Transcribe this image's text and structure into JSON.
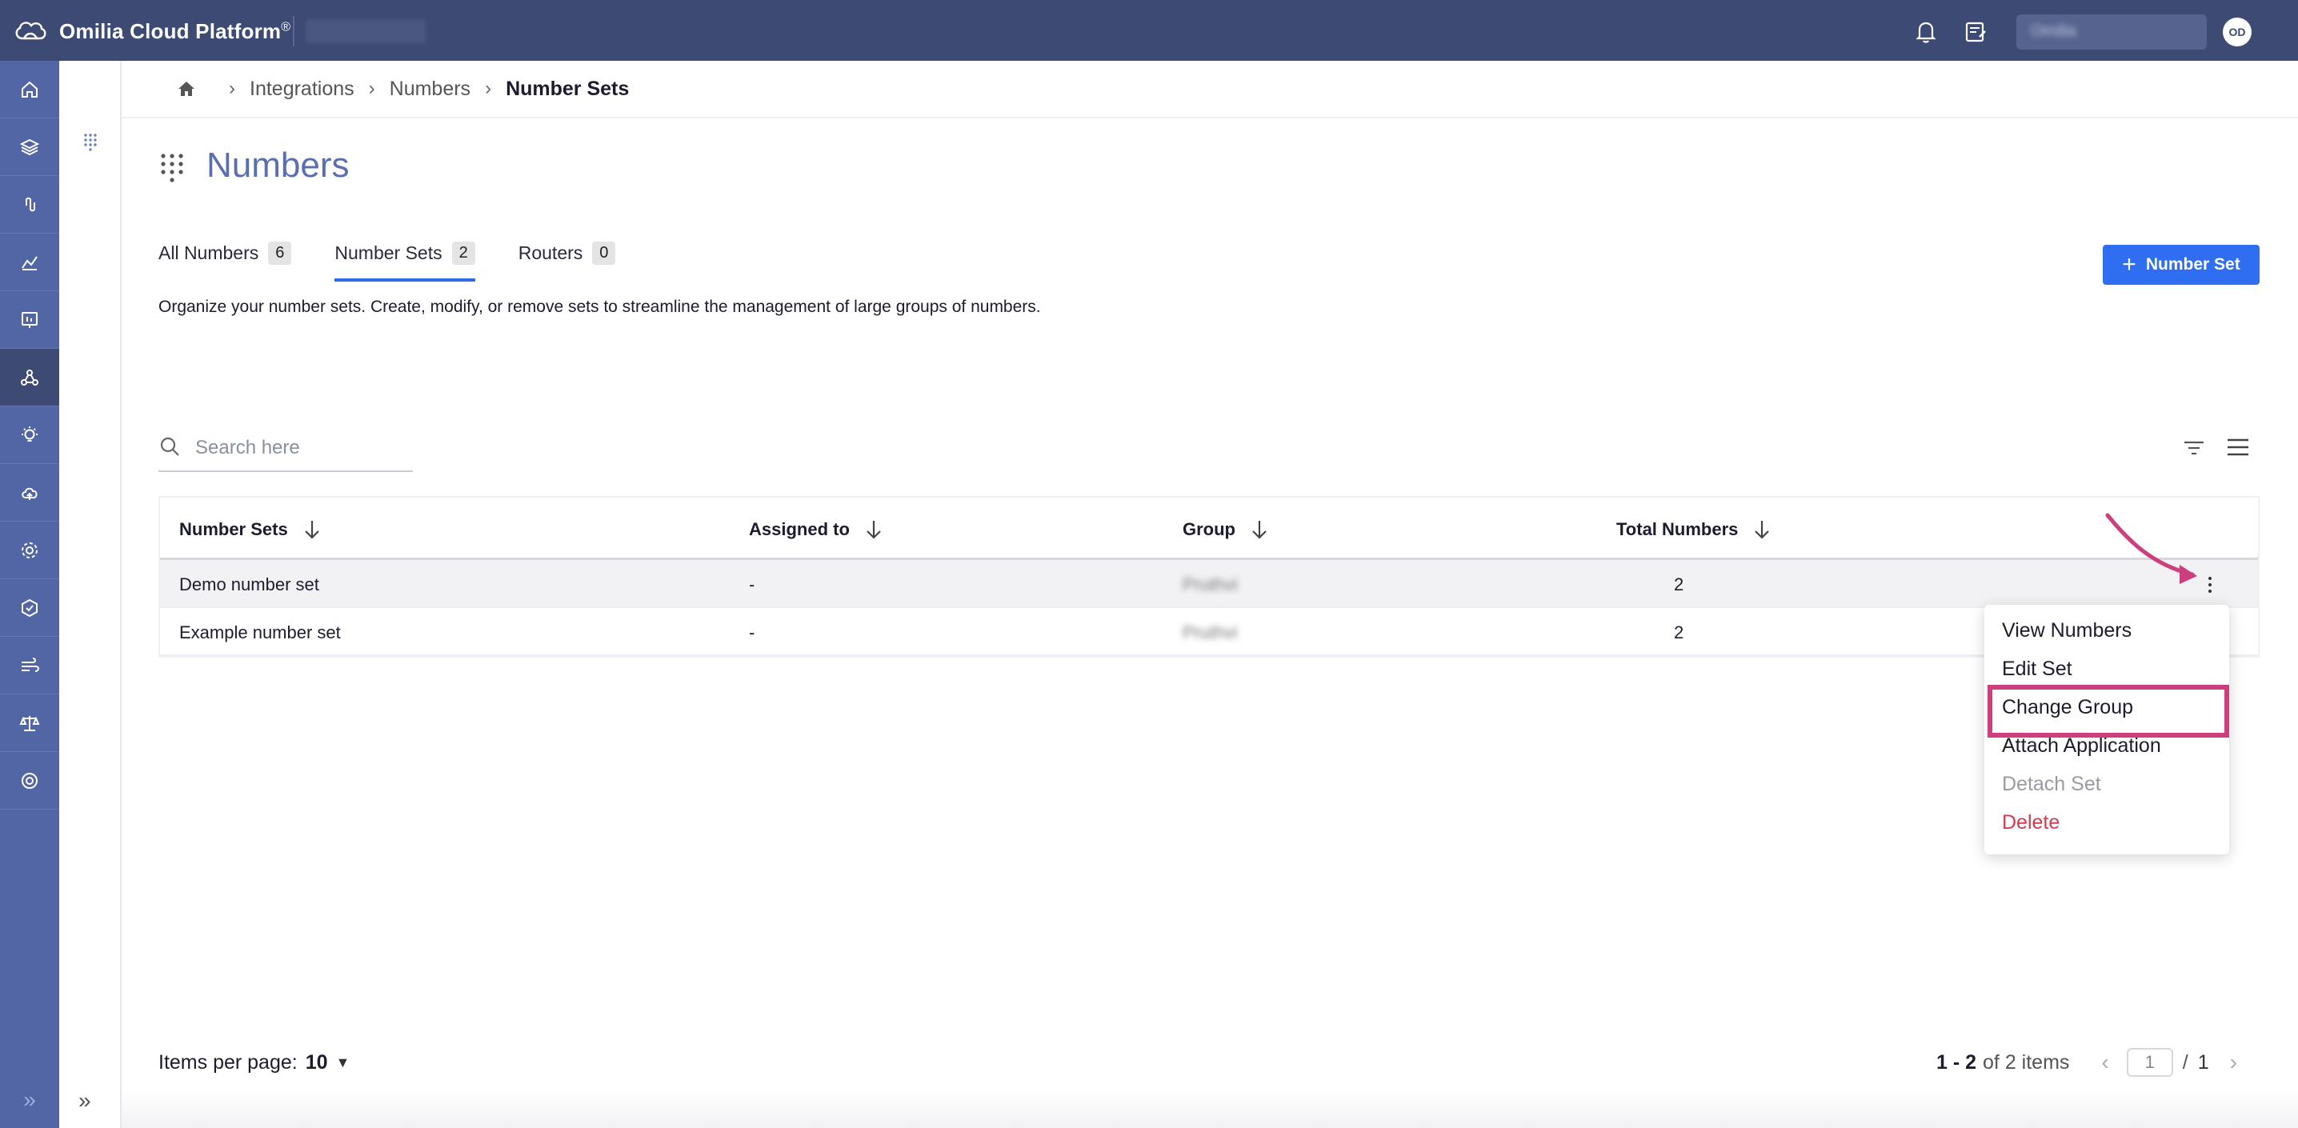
{
  "topbar": {
    "app_title": "Omilia Cloud Platform",
    "registered_mark": "®",
    "user_name": "Omilia",
    "avatar_initials": "OD",
    "icons": [
      "cloud-logo-icon",
      "bell-icon",
      "notes-icon"
    ]
  },
  "rail": {
    "items": [
      "home-icon",
      "layers-icon",
      "clip-icon",
      "analytics-icon",
      "presentation-icon",
      "integrations-icon",
      "bulb-icon",
      "cloud-upload-icon",
      "settings-icon",
      "shield-icon",
      "wind-icon",
      "scales-icon",
      "support-icon"
    ],
    "active_index": 5,
    "colors": {
      "rail": "#5266a5",
      "active": "#3d4a74",
      "topbar": "#3d4a74"
    }
  },
  "breadcrumb": {
    "items": [
      "Integrations",
      "Numbers"
    ],
    "current": "Number Sets",
    "separator": "›"
  },
  "page": {
    "title": "Numbers",
    "description": "Organize your number sets. Create, modify, or remove sets to streamline the management of large groups of numbers.",
    "add_button_label": "Number Set",
    "tabs": [
      {
        "label": "All Numbers",
        "count": "6"
      },
      {
        "label": "Number Sets",
        "count": "2"
      },
      {
        "label": "Routers",
        "count": "0"
      }
    ],
    "active_tab": "Number Sets"
  },
  "search": {
    "placeholder": "Search here"
  },
  "table": {
    "columns": [
      "Number Sets",
      "Assigned to",
      "Group",
      "Total Numbers"
    ],
    "rows": [
      {
        "name": "Demo number set",
        "assigned": "-",
        "group": "Pruthvi",
        "total": "2"
      },
      {
        "name": "Example number set",
        "assigned": "-",
        "group": "Pruthvi",
        "total": "2"
      }
    ]
  },
  "row_menu": {
    "items": [
      {
        "label": "View Numbers",
        "state": "normal"
      },
      {
        "label": "Edit Set",
        "state": "normal"
      },
      {
        "label": "Change Group",
        "state": "highlighted"
      },
      {
        "label": "Attach Application",
        "state": "normal"
      },
      {
        "label": "Detach Set",
        "state": "disabled"
      },
      {
        "label": "Delete",
        "state": "danger"
      }
    ],
    "highlight_color": "#cc3f7c",
    "danger_color": "#d43a4d"
  },
  "footer": {
    "items_per_page_label": "Items per page:",
    "items_per_page_value": "10",
    "range": "1 - 2",
    "range_suffix": "of 2 items",
    "current_page": "1",
    "total_pages": "1"
  },
  "accent_color": "#2f6ef0"
}
